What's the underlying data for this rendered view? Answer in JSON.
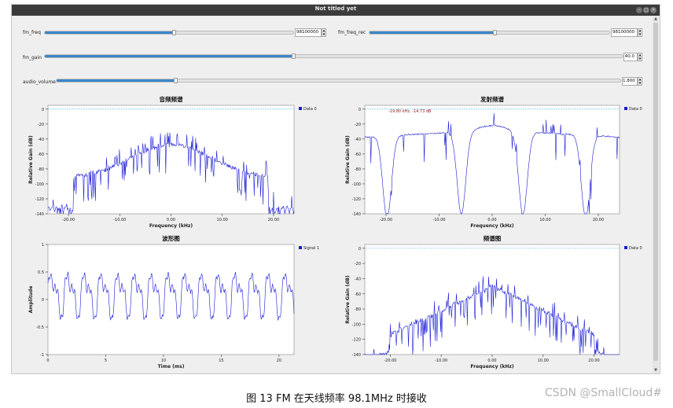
{
  "window": {
    "title": "Not titled yet"
  },
  "controls": {
    "fm_freq": {
      "label": "fm_freq",
      "value": "98100000",
      "fraction": 0.52
    },
    "fm_freq_rec": {
      "label": "fm_freq_rec",
      "value": "98100000",
      "fraction": 0.52
    },
    "fm_gain": {
      "label": "fm_gain",
      "value": "40.0",
      "fraction": 0.43
    },
    "audio_volume": {
      "label": "audio_volume",
      "value": "1.800",
      "fraction": 0.21
    }
  },
  "plots": {
    "audio_spectrum": {
      "title": "音频频谱",
      "legend": "Data 0",
      "xlabel": "Frequency (kHz)",
      "ylabel": "Relative Gain (dB)"
    },
    "tx_spectrum": {
      "title": "发射频谱",
      "legend": "Data 0",
      "xlabel": "Frequency (kHz)",
      "ylabel": "Relative Gain (dB)",
      "marker": "-19.80 kHz, -14.73 dB"
    },
    "waveform": {
      "title": "波形图",
      "legend": "Signal 1",
      "xlabel": "Time (ms)",
      "ylabel": "Amplitude"
    },
    "spectrum": {
      "title": "频谱图",
      "legend": "Data 0",
      "xlabel": "Frequency (kHz)",
      "ylabel": "Relative Gain (dB)"
    }
  },
  "chart_data": [
    {
      "type": "line",
      "title": "音频频谱",
      "xlabel": "Frequency (kHz)",
      "ylabel": "Relative Gain (dB)",
      "xlim": [
        -24,
        24
      ],
      "ylim": [
        -140,
        5
      ],
      "xticks": [
        "-20.00",
        "-10.00",
        "0.00",
        "10.00",
        "20.00"
      ],
      "yticks": [
        "0",
        "-20",
        "-40",
        "-60",
        "-80",
        "-100",
        "-120",
        "-140"
      ],
      "reference_line": 0,
      "series": [
        {
          "name": "Data 0",
          "shape": "flat-top band",
          "x": [
            -24,
            -19,
            -18.5,
            -10,
            0,
            10,
            18.5,
            19,
            24
          ],
          "y": [
            -135,
            -133,
            -92,
            -80,
            -55,
            -80,
            -92,
            -133,
            -135
          ]
        }
      ]
    },
    {
      "type": "line",
      "title": "发射频谱",
      "xlabel": "Frequency (kHz)",
      "ylabel": "Relative Gain (dB)",
      "xlim": [
        -24,
        24
      ],
      "ylim": [
        -140,
        5
      ],
      "xticks": [
        "-20.00",
        "-10.00",
        "0.00",
        "10.00",
        "20.00"
      ],
      "yticks": [
        "0",
        "-20",
        "-40",
        "-60",
        "-80",
        "-100",
        "-120",
        "-140"
      ],
      "reference_line": 0,
      "annotation": "-19.80 kHz, -14.73 dB",
      "series": [
        {
          "name": "Data 0",
          "x": [
            -22,
            -19.8,
            -12,
            -10,
            -5.8,
            0,
            5.8,
            10,
            12,
            17.5,
            21,
            24
          ],
          "y": [
            -30,
            -140,
            -42,
            -42,
            -137,
            -20,
            -137,
            -40,
            -42,
            -138,
            -27,
            -30
          ]
        }
      ]
    },
    {
      "type": "line",
      "title": "波形图",
      "xlabel": "Time (ms)",
      "ylabel": "Amplitude",
      "xlim": [
        0,
        21.3
      ],
      "ylim": [
        -1,
        1
      ],
      "xticks": [
        "0",
        "5",
        "10",
        "15",
        "20"
      ],
      "yticks": [
        "1",
        "0.5",
        "0",
        "-0.5",
        "-1"
      ],
      "series": [
        {
          "name": "Signal 1",
          "period_ms": 1.45,
          "amplitude_range": [
            -0.4,
            0.6
          ]
        }
      ]
    },
    {
      "type": "line",
      "title": "频谱图",
      "xlabel": "Frequency (kHz)",
      "ylabel": "Relative Gain (dB)",
      "xlim": [
        -25,
        25
      ],
      "ylim": [
        -140,
        5
      ],
      "xticks": [
        "-20.00",
        "-10.00",
        "0.00",
        "10.00",
        "20.00"
      ],
      "yticks": [
        "0",
        "-20",
        "-40",
        "-60",
        "-80",
        "-100",
        "-120",
        "-140"
      ],
      "reference_line": 0,
      "series": [
        {
          "name": "Data 0",
          "shape": "triangular peak",
          "x": [
            -24,
            -20,
            -10,
            0,
            10,
            20,
            24
          ],
          "y": [
            -125,
            -100,
            -85,
            -50,
            -85,
            -100,
            -130
          ]
        }
      ]
    }
  ],
  "caption": "图 13 FM 在天线频率 98.1MHz 时接收",
  "watermark": "CSDN @SmallCloud#",
  "colors": {
    "trace": "#1c1cd6",
    "slider_fill": "#3a86c8",
    "reference": "#6fc4dd",
    "annotation": "#8b1a1a"
  }
}
